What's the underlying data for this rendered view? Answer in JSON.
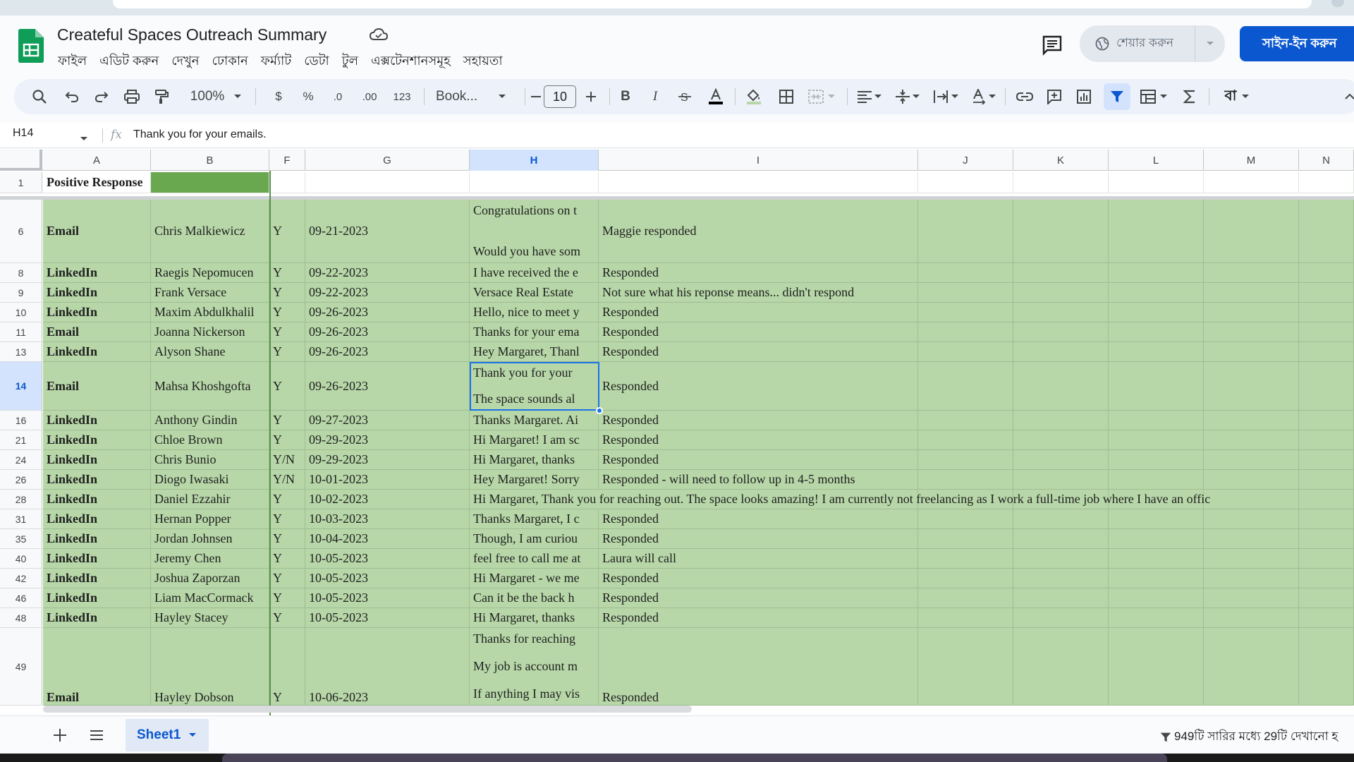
{
  "header": {
    "title": "Createful Spaces Outreach Summary",
    "menu": [
      "ফাইল",
      "এডিট করুন",
      "দেখুন",
      "ঢোকান",
      "ফর্ম্যাট",
      "ডেটা",
      "টুল",
      "এক্সটেনশানসমূহ",
      "সহায়তা"
    ],
    "share_label": "শেয়ার করুন",
    "signin_label": "সাইন-ইন করুন"
  },
  "toolbar": {
    "zoom": "100%",
    "currency": "$",
    "percent": "%",
    "decrease_decimal": ".0",
    "increase_decimal": ".00",
    "number_format": "123",
    "font": "Book...",
    "font_size": "10",
    "bold": "B",
    "italic": "I",
    "input_tools": "বা"
  },
  "formula_bar": {
    "cell_ref": "H14",
    "content": "Thank you for your emails."
  },
  "columns": [
    {
      "label": "A",
      "active": false
    },
    {
      "label": "B",
      "active": false
    },
    {
      "label": "F",
      "active": false
    },
    {
      "label": "G",
      "active": false
    },
    {
      "label": "H",
      "active": true
    },
    {
      "label": "I",
      "active": false
    },
    {
      "label": "J",
      "active": false
    },
    {
      "label": "K",
      "active": false
    },
    {
      "label": "L",
      "active": false
    },
    {
      "label": "M",
      "active": false
    },
    {
      "label": "N",
      "active": false
    }
  ],
  "header_row": {
    "num": "1",
    "a": "Positive Response"
  },
  "rows": [
    {
      "num": "6",
      "a": "Email",
      "b": "Chris Malkiewicz",
      "f": "Y",
      "g": "09-21-2023",
      "h_lines": [
        "Congratulations on t",
        "Would you have som"
      ],
      "i": "Maggie responded"
    },
    {
      "num": "8",
      "a": "LinkedIn",
      "b": "Raegis Nepomucen",
      "f": "Y",
      "g": "09-22-2023",
      "h": "I have received the e",
      "i": "Responded"
    },
    {
      "num": "9",
      "a": "LinkedIn",
      "b": "Frank Versace",
      "f": "Y",
      "g": "09-22-2023",
      "h": "Versace Real Estate",
      "i": "Not sure what his reponse means... didn't respond"
    },
    {
      "num": "10",
      "a": "LinkedIn",
      "b": "Maxim Abdulkhalil",
      "f": "Y",
      "g": "09-26-2023",
      "h": "Hello, nice to meet y",
      "i": "Responded"
    },
    {
      "num": "11",
      "a": "Email",
      "b": "Joanna Nickerson",
      "f": "Y",
      "g": "09-26-2023",
      "h": "Thanks for your ema",
      "i": "Responded"
    },
    {
      "num": "13",
      "a": "LinkedIn",
      "b": "Alyson Shane",
      "f": "Y",
      "g": "09-26-2023",
      "h": "Hey Margaret, Thanl",
      "i": "Responded"
    },
    {
      "num": "14",
      "a": "Email",
      "b": "Mahsa Khoshgofta",
      "f": "Y",
      "g": "09-26-2023",
      "h_lines": [
        "Thank you for your",
        "The space sounds al"
      ],
      "i": "Responded"
    },
    {
      "num": "16",
      "a": "LinkedIn",
      "b": "Anthony Gindin",
      "f": "Y",
      "g": "09-27-2023",
      "h": "Thanks Margaret. Ai",
      "i": "Responded"
    },
    {
      "num": "21",
      "a": "LinkedIn",
      "b": "Chloe Brown",
      "f": "Y",
      "g": "09-29-2023",
      "h": "Hi Margaret! I am sc",
      "i": "Responded"
    },
    {
      "num": "24",
      "a": "LinkedIn",
      "b": "Chris Bunio",
      "f": "Y/N",
      "g": "09-29-2023",
      "h": "Hi Margaret, thanks",
      "i": "Responded"
    },
    {
      "num": "26",
      "a": "LinkedIn",
      "b": "Diogo Iwasaki",
      "f": "Y/N",
      "g": "10-01-2023",
      "h": "Hey Margaret! Sorry",
      "i": "Responded - will need to follow up in 4-5 months"
    },
    {
      "num": "28",
      "a": "LinkedIn",
      "b": "Daniel Ezzahir",
      "f": "Y",
      "g": "10-02-2023",
      "h_overflow": "Hi Margaret, Thank you for reaching out. The space looks amazing! I am currently not freelancing as I work a full-time job where I have an offic",
      "i": ""
    },
    {
      "num": "31",
      "a": "LinkedIn",
      "b": "Hernan Popper",
      "f": "Y",
      "g": "10-03-2023",
      "h": "Thanks Margaret, I c",
      "i": "Responded"
    },
    {
      "num": "35",
      "a": "LinkedIn",
      "b": "Jordan Johnsen",
      "f": "Y",
      "g": "10-04-2023",
      "h": "Though, I am curiou",
      "i": "Responded"
    },
    {
      "num": "40",
      "a": "LinkedIn",
      "b": "Jeremy Chen",
      "f": "Y",
      "g": "10-05-2023",
      "h": "feel free to call me at",
      "i": "Laura will call"
    },
    {
      "num": "42",
      "a": "LinkedIn",
      "b": "Joshua Zaporzan",
      "f": "Y",
      "g": "10-05-2023",
      "h": "Hi Margaret - we me",
      "i": "Responded"
    },
    {
      "num": "46",
      "a": "LinkedIn",
      "b": "Liam MacCormack",
      "f": "Y",
      "g": "10-05-2023",
      "h": "Can it be the back h",
      "i": "Responded"
    },
    {
      "num": "48",
      "a": "LinkedIn",
      "b": "Hayley Stacey",
      "f": "Y",
      "g": "10-05-2023",
      "h": "Hi Margaret, thanks",
      "i": "Responded"
    },
    {
      "num": "49",
      "a": "Email",
      "b": "Hayley Dobson",
      "f": "Y",
      "g": "10-06-2023",
      "h_lines": [
        "Thanks for reaching",
        "My job is account m",
        "If anything I may vis"
      ],
      "i": "Responded"
    }
  ],
  "sheet_tab": "Sheet1",
  "status": "949টি সারির মধ্যে 29টি দেখানো হ",
  "colors": {
    "cell_fill": "#b7d7a8",
    "header_fill": "#6aa84f",
    "accent": "#0b57d0",
    "selection": "#1a73e8"
  }
}
